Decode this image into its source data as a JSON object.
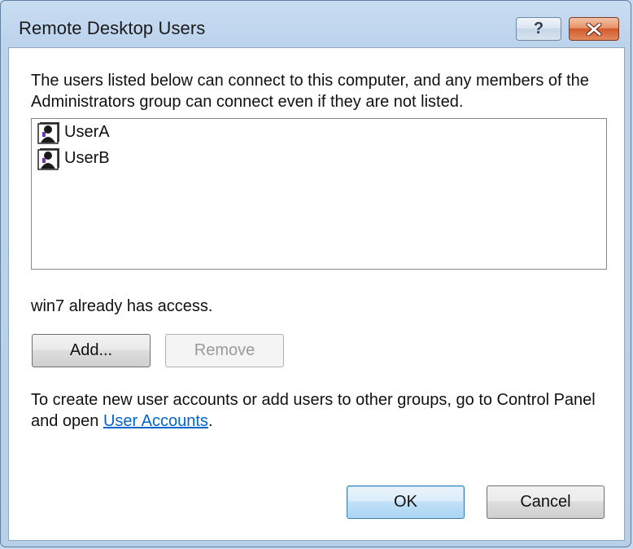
{
  "window": {
    "title": "Remote Desktop Users",
    "help_label": "?"
  },
  "dialog": {
    "description": "The users listed below can connect to this computer, and any members of the Administrators group can connect even if they are not listed.",
    "users": [
      {
        "name": "UserA",
        "icon": "user-icon"
      },
      {
        "name": "UserB",
        "icon": "user-icon"
      }
    ],
    "status": "win7 already has access.",
    "add_label": "Add...",
    "remove_label": "Remove",
    "info_prefix": "To create new user accounts or add users to other groups, go to Control Panel and open ",
    "info_link": "User Accounts",
    "info_suffix": ".",
    "ok_label": "OK",
    "cancel_label": "Cancel"
  },
  "colors": {
    "link": "#0066cc",
    "close_button": "#d2592c",
    "default_button_border": "#3c7fb1"
  }
}
